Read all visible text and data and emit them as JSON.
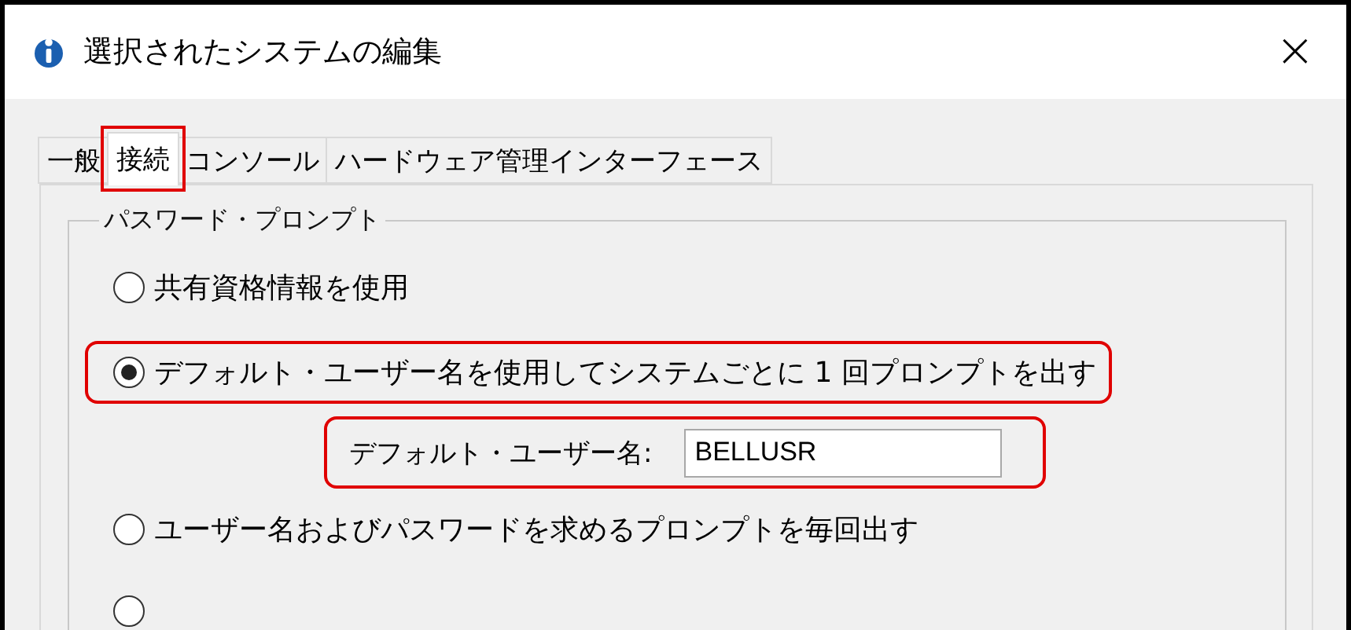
{
  "window": {
    "title": "選択されたシステムの編集",
    "close": "×"
  },
  "tabs": [
    {
      "label": "一般",
      "selected": false,
      "highlighted": false
    },
    {
      "label": "接続",
      "selected": true,
      "highlighted": true
    },
    {
      "label": "コンソール",
      "selected": false,
      "highlighted": false
    },
    {
      "label": "ハードウェア管理インターフェース",
      "selected": false,
      "highlighted": false
    }
  ],
  "group": {
    "title": "パスワード・プロンプト",
    "options": [
      {
        "kind": "radio",
        "label": "共有資格情報を使用",
        "selected": false,
        "highlighted": false
      },
      {
        "kind": "radio",
        "label": "デフォルト・ユーザー名を使用してシステムごとに 1  回プロンプトを出す",
        "selected": true,
        "highlighted": true
      },
      {
        "kind": "field",
        "label": "デフォルト・ユーザー名:",
        "value": "BELLUSR",
        "highlighted": true
      },
      {
        "kind": "radio",
        "label": "ユーザー名およびパスワードを求めるプロンプトを毎回出す",
        "selected": false,
        "highlighted": false
      },
      {
        "kind": "radio",
        "selected": false,
        "highlighted": false
      }
    ]
  }
}
